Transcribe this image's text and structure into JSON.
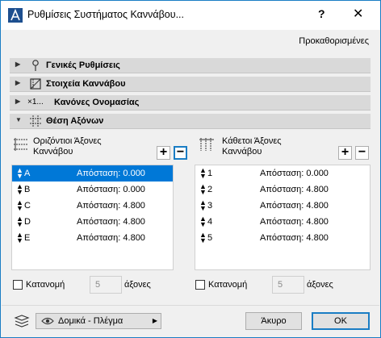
{
  "window": {
    "title": "Ρυθμίσεις Συστήματος Καννάβου...",
    "help_label": "?",
    "close_label": "✕"
  },
  "preset_link": "Προκαθορισμένες",
  "sections": [
    {
      "label": "Γενικές Ρυθμίσεις",
      "icon": "pin-icon",
      "expanded": false
    },
    {
      "label": "Στοιχεία Καννάβου",
      "icon": "grid-element-icon",
      "expanded": false
    },
    {
      "label": "Κανόνες Ονομασίας",
      "icon": "naming-rules-icon",
      "icon_text": "×1...",
      "expanded": false
    },
    {
      "label": "Θέση Αξόνων",
      "icon": "axis-grid-icon",
      "expanded": true
    }
  ],
  "horizontal": {
    "title_line1": "Οριζόντιοι Άξονες",
    "title_line2": "Καννάβου",
    "add_label": "+",
    "remove_label": "−",
    "rows": [
      {
        "name": "A",
        "distance": "Απόσταση: 0.000",
        "selected": true
      },
      {
        "name": "B",
        "distance": "Απόσταση: 0.000",
        "selected": false
      },
      {
        "name": "C",
        "distance": "Απόσταση: 4.800",
        "selected": false
      },
      {
        "name": "D",
        "distance": "Απόσταση: 4.800",
        "selected": false
      },
      {
        "name": "E",
        "distance": "Απόσταση: 4.800",
        "selected": false
      }
    ],
    "distribute_label": "Κατανομή",
    "count_value": "5",
    "unit_label": "άξονες"
  },
  "vertical": {
    "title_line1": "Κάθετοι Άξονες",
    "title_line2": "Καννάβου",
    "add_label": "+",
    "remove_label": "−",
    "rows": [
      {
        "name": "1",
        "distance": "Απόσταση: 0.000",
        "selected": false
      },
      {
        "name": "2",
        "distance": "Απόσταση: 4.800",
        "selected": false
      },
      {
        "name": "3",
        "distance": "Απόσταση: 4.800",
        "selected": false
      },
      {
        "name": "4",
        "distance": "Απόσταση: 4.800",
        "selected": false
      },
      {
        "name": "5",
        "distance": "Απόσταση: 4.800",
        "selected": false
      }
    ],
    "distribute_label": "Κατανομή",
    "count_value": "5",
    "unit_label": "άξονες"
  },
  "footer": {
    "layer_value": "Δομικά - Πλέγμα",
    "cancel_label": "Άκυρο",
    "ok_label": "OK"
  },
  "colors": {
    "accent": "#1a7dc4",
    "selection": "#0078d7",
    "section_header": "#d9d9d9",
    "window_bg": "#f0f0f0"
  }
}
